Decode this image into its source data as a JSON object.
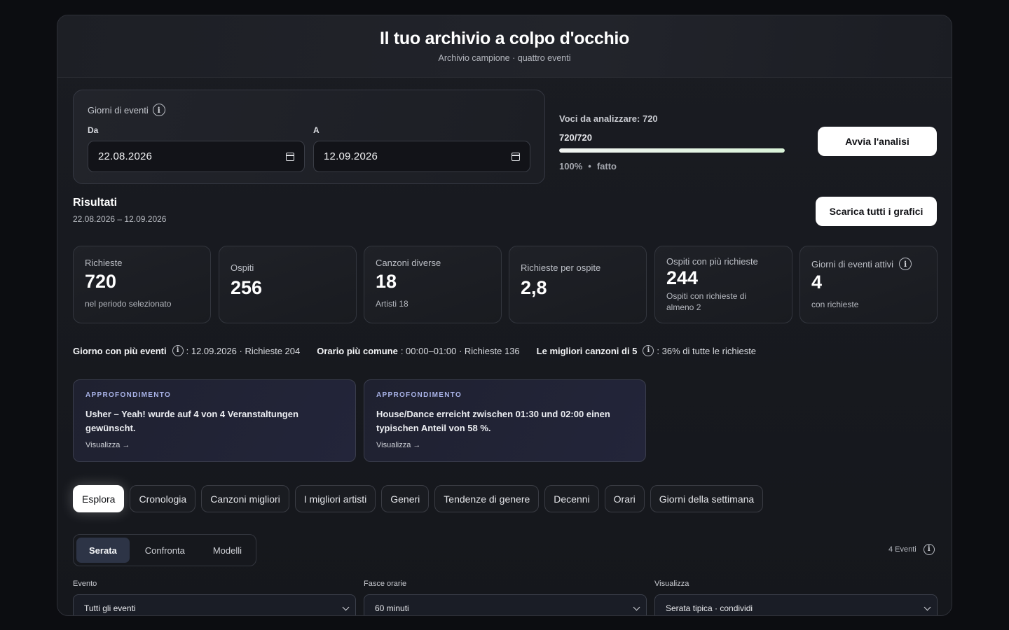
{
  "header": {
    "title": "Il tuo archivio a colpo d'occhio",
    "subtitle": "Archivio campione · quattro eventi"
  },
  "date_range": {
    "title": "Giorni di eventi",
    "from_label": "Da",
    "from_value": "22.08.2026",
    "to_label": "A",
    "to_value": "12.09.2026"
  },
  "analysis": {
    "items_label": "Voci da analizzare: 720",
    "progress_text": "720/720",
    "progress_fraction": 1.0,
    "percent": "100%",
    "separator": "•",
    "status": "fatto",
    "start_button": "Avvia l'analisi"
  },
  "results": {
    "title": "Risultati",
    "range": "22.08.2026 – 12.09.2026",
    "download_button": "Scarica tutti i grafici"
  },
  "stats": [
    {
      "label": "Richieste",
      "value": "720",
      "note": "nel periodo selezionato"
    },
    {
      "label": "Ospiti",
      "value": "256",
      "note": ""
    },
    {
      "label": "Canzoni diverse",
      "value": "18",
      "note": "Artisti 18"
    },
    {
      "label": "Richieste per ospite",
      "value": "2,8",
      "note": ""
    },
    {
      "label": "Ospiti con più richieste",
      "value": "244",
      "note": "Ospiti con richieste di almeno 2"
    },
    {
      "label": "Giorni di eventi attivi",
      "value": "4",
      "note": "con richieste"
    }
  ],
  "summary": {
    "busiest_day_label": "Giorno con più eventi",
    "busiest_day_value": ": 12.09.2026 · Richieste 204",
    "common_time_label": "Orario più comune",
    "common_time_value": ": 00:00–01:00 · Richieste 136",
    "top_songs_label": "Le migliori canzoni di 5",
    "top_songs_value": ": 36% di tutte le richieste"
  },
  "insights": [
    {
      "kicker": "APPROFONDIMENTO",
      "text": "Usher – Yeah! wurde auf 4 von 4 Veranstaltungen gewünscht.",
      "link": "Visualizza →"
    },
    {
      "kicker": "APPROFONDIMENTO",
      "text": "House/Dance erreicht zwischen 01:30 und 02:00 einen typischen Anteil von 58 %.",
      "link": "Visualizza →"
    }
  ],
  "tabs": [
    "Esplora",
    "Cronologia",
    "Canzoni migliori",
    "I migliori artisti",
    "Generi",
    "Tendenze di genere",
    "Decenni",
    "Orari",
    "Giorni della settimana"
  ],
  "active_tab": "Esplora",
  "subtabs": [
    "Serata",
    "Confronta",
    "Modelli"
  ],
  "active_subtab": "Serata",
  "events_count": "4 Eventi",
  "filters": {
    "event_label": "Evento",
    "event_value": "Tutti gli eventi",
    "slots_label": "Fasce orarie",
    "slots_value": "60 minuti",
    "view_label": "Visualizza",
    "view_value": "Serata tipica · condividi"
  },
  "colors": {
    "background": "#0c0d11",
    "card": "#1a1c22",
    "accent_insight": "#a9b3e8",
    "progress_fill": "#d9f3d8"
  }
}
